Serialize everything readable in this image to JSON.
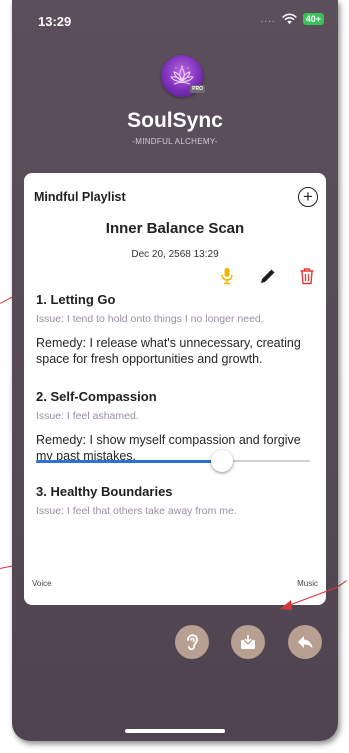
{
  "status_bar": {
    "time": "13:29",
    "signal_dots": "....",
    "battery": "40+",
    "battery_color": "#39c25a"
  },
  "app": {
    "name": "SoulSync",
    "tagline": "-MINDFUL ALCHEMY-",
    "logo_badge": "PRO",
    "accent_color": "#2d73d6"
  },
  "playlist": {
    "header": "Mindful Playlist",
    "add_icon": "plus-circle-icon",
    "add_symbol": "+",
    "title": "Inner Balance Scan",
    "date": "Dec 20, 2568 13:29",
    "tools": [
      "microphone-icon",
      "pencil-icon",
      "trash-icon"
    ],
    "items": [
      {
        "title": "1. Letting Go",
        "issue": "Issue: I tend to hold onto things I no longer need.",
        "remedy": "Remedy: I release what's unnecessary, creating space for fresh opportunities and growth."
      },
      {
        "title": "2. Self-Compassion",
        "issue": "Issue: I feel ashamed.",
        "remedy": "Remedy: I show myself compassion and forgive my past mistakes."
      },
      {
        "title": "3. Healthy Boundaries",
        "issue": "Issue: I feel that others take away from me.",
        "remedy": ""
      }
    ]
  },
  "mix_slider": {
    "left_label": "Voice",
    "right_label": "Music",
    "value_fraction": 0.68
  },
  "bottom_actions": [
    "hearing-icon",
    "download-icon",
    "share-icon"
  ]
}
